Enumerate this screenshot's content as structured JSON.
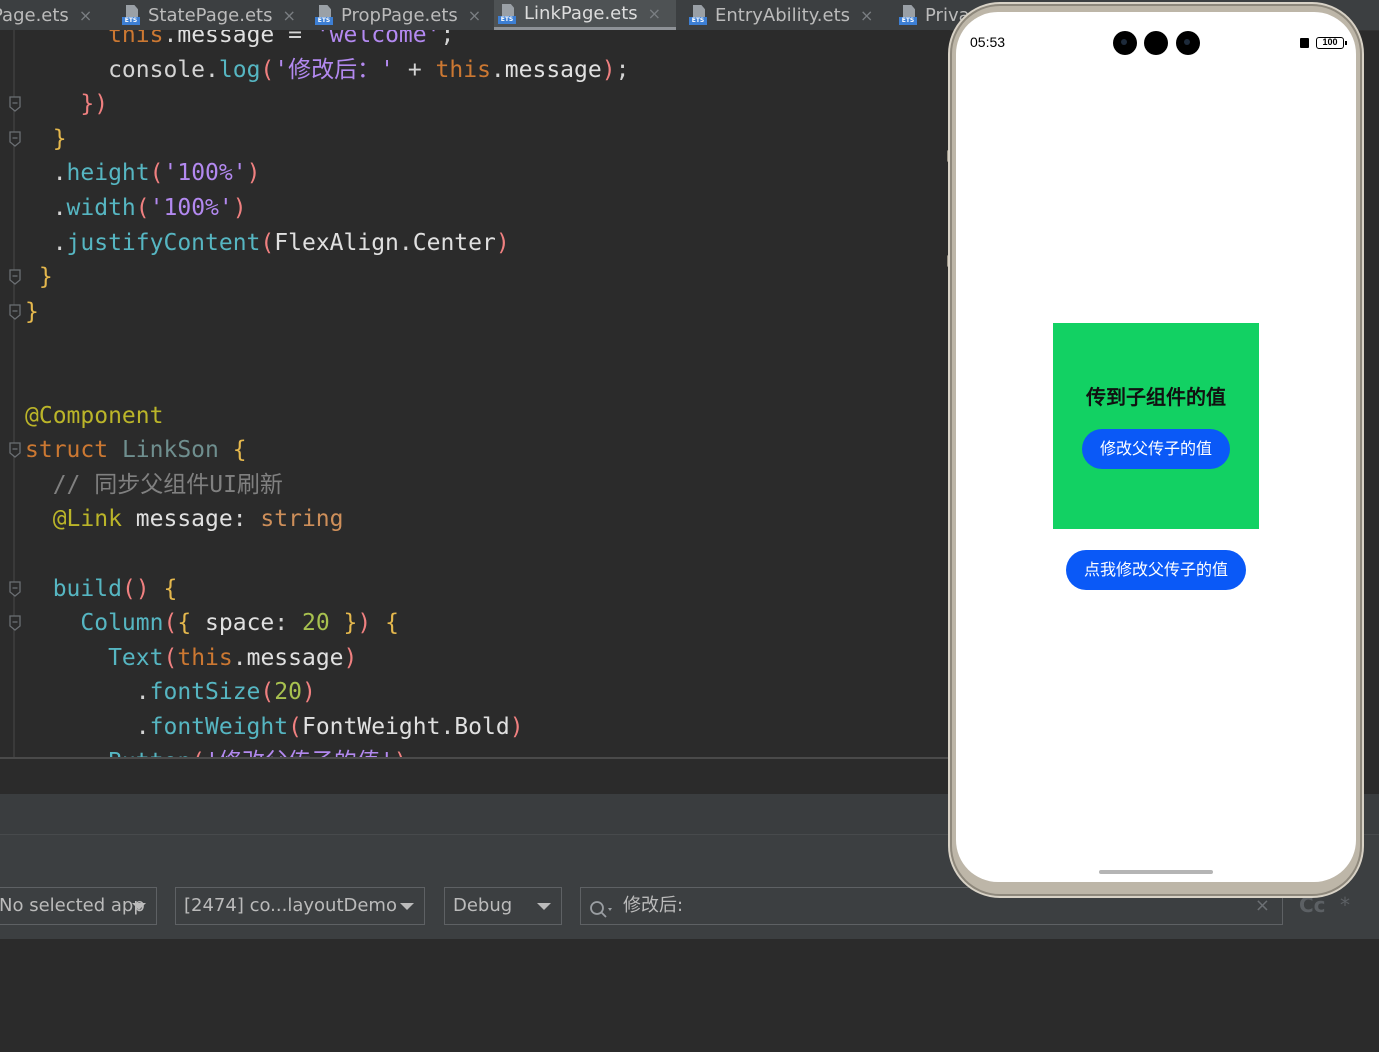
{
  "tabs": [
    {
      "label": "Page.ets",
      "active": false,
      "has_icon": false
    },
    {
      "label": "StatePage.ets",
      "active": false,
      "has_icon": true
    },
    {
      "label": "PropPage.ets",
      "active": false,
      "has_icon": true
    },
    {
      "label": "LinkPage.ets",
      "active": true,
      "has_icon": true
    },
    {
      "label": "EntryAbility.ets",
      "active": false,
      "has_icon": true
    },
    {
      "label": "Priva",
      "active": false,
      "has_icon": true
    }
  ],
  "tab_close_glyph": "×",
  "tab_icon_badge": "ETS",
  "code_lines": [
    [
      [
        "k-keyword",
        "      this"
      ],
      [
        "k-default",
        "."
      ],
      [
        "k-prop",
        "message"
      ],
      [
        "k-default",
        " = "
      ],
      [
        "k-string",
        "'welcome'"
      ],
      [
        "k-default",
        ";"
      ]
    ],
    [
      [
        "k-default",
        "      console"
      ],
      [
        "k-default",
        "."
      ],
      [
        "k-func",
        "log"
      ],
      [
        "k-paren",
        "("
      ],
      [
        "k-string",
        "'修改后：'"
      ],
      [
        "k-default",
        " + "
      ],
      [
        "k-keyword",
        "this"
      ],
      [
        "k-default",
        "."
      ],
      [
        "k-prop",
        "message"
      ],
      [
        "k-paren",
        ")"
      ],
      [
        "k-default",
        ";"
      ]
    ],
    [
      [
        "k-paren",
        "    })"
      ]
    ],
    [
      [
        "k-brace",
        "  }"
      ]
    ],
    [
      [
        "k-default",
        "  ."
      ],
      [
        "k-func",
        "height"
      ],
      [
        "k-paren",
        "("
      ],
      [
        "k-string",
        "'100%'"
      ],
      [
        "k-paren",
        ")"
      ]
    ],
    [
      [
        "k-default",
        "  ."
      ],
      [
        "k-func",
        "width"
      ],
      [
        "k-paren",
        "("
      ],
      [
        "k-string",
        "'100%'"
      ],
      [
        "k-paren",
        ")"
      ]
    ],
    [
      [
        "k-default",
        "  ."
      ],
      [
        "k-func",
        "justifyContent"
      ],
      [
        "k-paren",
        "("
      ],
      [
        "k-prop",
        "FlexAlign"
      ],
      [
        "k-default",
        "."
      ],
      [
        "k-prop",
        "Center"
      ],
      [
        "k-paren",
        ")"
      ]
    ],
    [
      [
        "k-brace",
        " }"
      ]
    ],
    [
      [
        "k-brace",
        "}"
      ]
    ],
    [],
    [],
    [
      [
        "k-anno",
        "@Component"
      ]
    ],
    [
      [
        "k-keyword",
        "struct "
      ],
      [
        "k-class",
        "LinkSon "
      ],
      [
        "k-brace",
        "{"
      ]
    ],
    [
      [
        "k-comment",
        "  // 同步父组件UI刷新"
      ]
    ],
    [
      [
        "k-anno",
        "  @Link "
      ],
      [
        "k-prop",
        "message"
      ],
      [
        "k-default",
        ": "
      ],
      [
        "k-type",
        "string"
      ]
    ],
    [],
    [
      [
        "k-func",
        "  build"
      ],
      [
        "k-paren",
        "()"
      ],
      [
        "k-default",
        " "
      ],
      [
        "k-brace",
        "{"
      ]
    ],
    [
      [
        "k-func",
        "    Column"
      ],
      [
        "k-paren",
        "("
      ],
      [
        "k-brace",
        "{ "
      ],
      [
        "k-prop",
        "space"
      ],
      [
        "k-default",
        ": "
      ],
      [
        "k-number",
        "20"
      ],
      [
        "k-brace",
        " }"
      ],
      [
        "k-paren",
        ")"
      ],
      [
        "k-default",
        " "
      ],
      [
        "k-brace",
        "{"
      ]
    ],
    [
      [
        "k-func",
        "      Text"
      ],
      [
        "k-paren",
        "("
      ],
      [
        "k-keyword",
        "this"
      ],
      [
        "k-default",
        "."
      ],
      [
        "k-prop",
        "message"
      ],
      [
        "k-paren",
        ")"
      ]
    ],
    [
      [
        "k-default",
        "        ."
      ],
      [
        "k-func",
        "fontSize"
      ],
      [
        "k-paren",
        "("
      ],
      [
        "k-number",
        "20"
      ],
      [
        "k-paren",
        ")"
      ]
    ],
    [
      [
        "k-default",
        "        ."
      ],
      [
        "k-func",
        "fontWeight"
      ],
      [
        "k-paren",
        "("
      ],
      [
        "k-prop",
        "FontWeight"
      ],
      [
        "k-default",
        "."
      ],
      [
        "k-prop",
        "Bold"
      ],
      [
        "k-paren",
        ")"
      ]
    ],
    [
      [
        "k-func",
        "      Button"
      ],
      [
        "k-paren",
        "("
      ],
      [
        "k-string",
        "'修改父传子的值'"
      ],
      [
        "k-paren",
        ")"
      ]
    ]
  ],
  "toolbar": {
    "app_select": "No selected app",
    "process_select": "[2474] co...layoutDemo",
    "level_select": "Debug",
    "search_value": "修改后:",
    "search_clear": "×",
    "case_toggle": "Cc",
    "regex_toggle": "*"
  },
  "phone": {
    "status_time": "05:53",
    "battery": "100",
    "child_text": "传到子组件的值",
    "child_button": "修改父传子的值",
    "parent_button": "点我修改父传子的值",
    "box_color": "#12d163",
    "button_color": "#0a59f7"
  }
}
